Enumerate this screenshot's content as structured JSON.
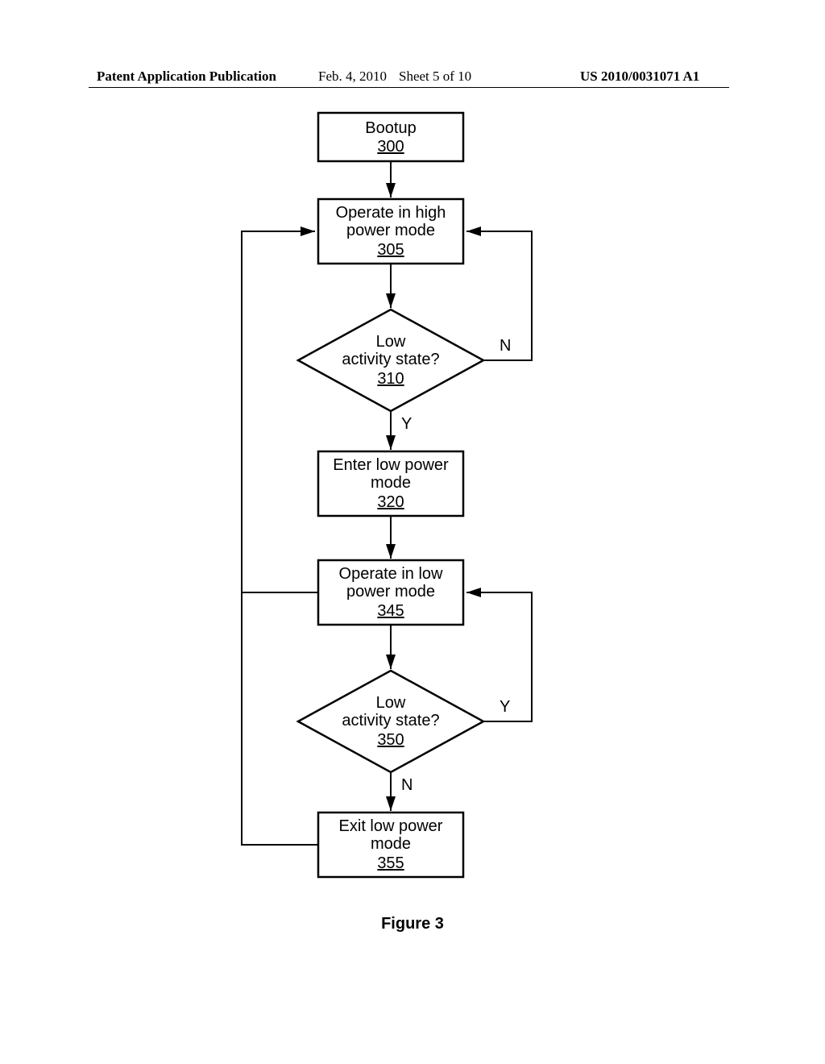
{
  "header": {
    "publication_label": "Patent Application Publication",
    "date": "Feb. 4, 2010",
    "sheet": "Sheet 5 of 10",
    "pubnum": "US 2010/0031071 A1"
  },
  "figure_label": "Figure 3",
  "nodes": {
    "bootup": {
      "label": "Bootup",
      "num": "300"
    },
    "high_power": {
      "label1": "Operate in high",
      "label2": "power mode",
      "num": "305"
    },
    "decision1": {
      "label1": "Low",
      "label2": "activity state?",
      "num": "310",
      "yes": "Y",
      "no": "N"
    },
    "enter_low": {
      "label1": "Enter low power",
      "label2": "mode",
      "num": "320"
    },
    "low_power": {
      "label1": "Operate in low",
      "label2": "power mode",
      "num": "345"
    },
    "decision2": {
      "label1": "Low",
      "label2": "activity state?",
      "num": "350",
      "yes": "Y",
      "no": "N"
    },
    "exit_low": {
      "label1": "Exit low power",
      "label2": "mode",
      "num": "355"
    }
  }
}
